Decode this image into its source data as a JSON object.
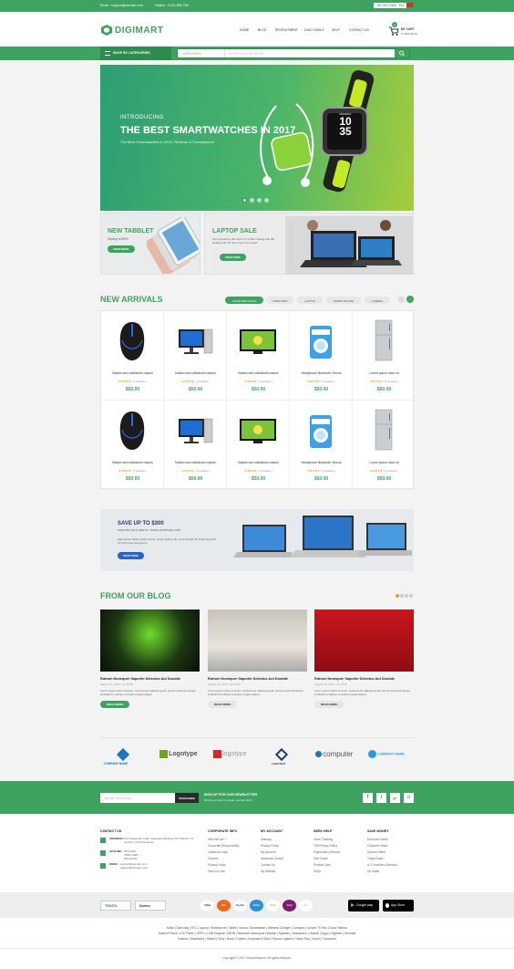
{
  "topbar": {
    "email": "Email : support@domain.com",
    "hotline": "Hotline : 0123-456-789",
    "account": "MY ACCOUNT",
    "lang": "EN"
  },
  "logo": {
    "text": "DIGIMART"
  },
  "nav": [
    "HOME",
    "BLOG",
    "RECRUITMENT",
    "DAILY DEALS",
    "HELP",
    "CONTACT US"
  ],
  "cart": {
    "label": "MY CART",
    "amount": "0 ITEM $0.00",
    "count": "0"
  },
  "catbar": {
    "label": "SHOP BY CATEGORIES",
    "select": "CATEGORIES",
    "placeholder": "ENTER YOUR KEYWORD"
  },
  "hero": {
    "intro": "INTRODUCING",
    "title": "THE BEST SMARTWATCHES IN 2017",
    "sub": "The Best Smartwatches in 2016- Reviews & Comparisons",
    "watch_time": "10 35",
    "watch_day": "MONDAY"
  },
  "banner1": {
    "title": "NEW TABBLET",
    "sub": "Starting at $599",
    "btn": "VIEW MORE"
  },
  "banner2": {
    "title": "LAPTOP SALE",
    "text": "Get inspired by this Self 2-in-1 with rotating Full HD display and 7th Gen Intel Core power",
    "btn": "SHOP NOW"
  },
  "new_arrivals": {
    "title": "NEW ARRIVALS",
    "tabs": [
      "HOME APPLIANCE",
      "COMPUTER",
      "LAPTOP",
      "SMART PHONE",
      "CAMERA"
    ],
    "products": [
      {
        "name": "Nullam sed sollicitudin mauris",
        "reviews": "( 3 reviews )",
        "price": "$50.00",
        "kind": "mouse"
      },
      {
        "name": "Nullam sed sollicitudin mauris",
        "reviews": "( 3 reviews )",
        "price": "$50.00",
        "kind": "pc"
      },
      {
        "name": "Nullam sed sollicitudin mauris",
        "reviews": "( 3 reviews )",
        "price": "$50.00",
        "kind": "tv"
      },
      {
        "name": "Headphone Bluetooth Vinova",
        "reviews": "( 3 reviews )",
        "price": "$50.00",
        "kind": "washer"
      },
      {
        "name": "Lorem ipsum dolor sit",
        "reviews": "( 3 reviews )",
        "price": "$50.00",
        "kind": "fridge"
      },
      {
        "name": "Nullam sed sollicitudin mauris",
        "reviews": "( 3 reviews )",
        "price": "$50.00",
        "kind": "mouse"
      },
      {
        "name": "Nullam sed sollicitudin mauris",
        "reviews": "( 3 reviews )",
        "price": "$50.00",
        "kind": "pc"
      },
      {
        "name": "Nullam sed sollicitudin mauris",
        "reviews": "( 3 reviews )",
        "price": "$50.00",
        "kind": "tv"
      },
      {
        "name": "Headphone Bluetooth Vinova",
        "reviews": "( 3 reviews )",
        "price": "$50.00",
        "kind": "washer"
      },
      {
        "name": "Lorem ipsum dolor sit",
        "reviews": "( 3 reviews )",
        "price": "$50.00",
        "kind": "fridge"
      }
    ],
    "stars": "★★★★★"
  },
  "save": {
    "title": "SAVE UP TO $300",
    "sub": "SAVE BIG ON A NEW PC, WHILE SUPPLIES LAST",
    "text": "Experience better performance, longer battery life, and smooth 4K streaming with 7th Gen Intel processors",
    "btn": "SHOP NOW"
  },
  "blog": {
    "title": "FROM OUR BLOG",
    "posts": [
      {
        "title": "Rutrum Nonequre Saporite Detectus Aut Doodde",
        "date": "August 19, 2017  |  22:15:00",
        "text": "Lorem ipsum dolor sit amet, consectetur adipiscing elit, sed do eiusmod tempor incididunt ut labore et dolore magna aliqua",
        "btn": "READ MORE"
      },
      {
        "title": "Rutrum Nonequre Saporite Detectus Aut Doodde",
        "date": "August 19, 2017  |  22:15:00",
        "text": "Lorem ipsum dolor sit amet, consectetur adipiscing elit, sed do eiusmod tempor incididunt ut labore et dolore magna aliqua",
        "btn": "READ MORE"
      },
      {
        "title": "Rutrum Nonequre Saporite Detectus Aut Doodde",
        "date": "August 19, 2017  |  22:15:00",
        "text": "Lorem ipsum dolor sit amet, consectetur adipiscing elit, sed do eiusmod tempor incididunt ut labore et dolore magna aliqua",
        "btn": "READ MORE"
      }
    ]
  },
  "brands": [
    "COMPANY NAME",
    "Logotype",
    "logotype",
    "LOGOTEXT",
    "computer",
    "COMPANY NAME"
  ],
  "newsletter": {
    "placeholder": "ENTER YOUR EMAIL",
    "btn": "SUBSCRIBE",
    "title": "SIGN UP FOR OUR NEWSLETTER",
    "sub": "Receive email only deals, special offers"
  },
  "footer": {
    "contact": {
      "title": "CONTACT US",
      "address_label": "ADDRESS :",
      "address": "123 Suspendis matti, Visaosang Building VST District, NY Accums, North American",
      "hotline_label": "HOTLINE :",
      "hotline": "0123-456-78910  0987-654-32100",
      "email_label": "EMAIL :",
      "email": "support@domain.com  digimart@domain.com"
    },
    "cols": [
      {
        "title": "CORPORATE INFO",
        "items": [
          "Who We Are ?",
          "Corporate Responsibility",
          "California Laws",
          "Careers",
          "Privacy Policy",
          "Terms of Use"
        ]
      },
      {
        "title": "MY ACCOUNT",
        "items": [
          "Sitemap",
          "Privacy Policy",
          "My Account",
          "Advanced Search",
          "Contact Us",
          "My Wishlist"
        ]
      },
      {
        "title": "NEED HELP",
        "items": [
          "Order Tracking",
          "The Privacy Policy",
          "Payments & Returns",
          "Size Guide",
          "Product Care",
          "FAQs"
        ]
      },
      {
        "title": "SAVE MONEY",
        "items": [
          "Discount Codes",
          "Customer Sales",
          "Special Offers",
          "Today Deals",
          "A-Z Vouchers Directory",
          "On Sales"
        ]
      }
    ]
  },
  "pay": {
    "trust": "TRUSTe",
    "norton": "Norton",
    "cards": [
      "VISA",
      "MC",
      "PayPal",
      "AMEX",
      "DISC",
      "Skrill",
      "C"
    ],
    "google": "Google play",
    "apple": "App Store"
  },
  "links": {
    "row1": "Nokia  |  Samsung  |  HTC  |  Laptop  |  Smartphone  |  Tablet  |  Vinova  |  Smartwatch  |  Wireless Charger  |  Company  |  Iphone 7S Plus  |  Nova Fashion",
    "row2": "Android Phone  |  IOS Phone  |  OPPO  |  USB Kingston 128GB  |  Bluetooth Motorcycle Headset  |  Speaker  |  Headphone  |  Huawei  |  Ziggo  |  Digimart  |  Vinomart",
    "row3": "Fashion  |  Blackberry  |  Hitachi  |  Sony  |  Nixon  |  Fujifilm  |  Keyboard E-Blue  |  Mouse Logitech  |  Game Pad  |  Canon  |  Transcend",
    "copy": "Copyright © 2017 VinovaShamon. All rights reserved."
  },
  "colors": {
    "green": "#3ea261",
    "dark_green": "#2f8c50"
  }
}
